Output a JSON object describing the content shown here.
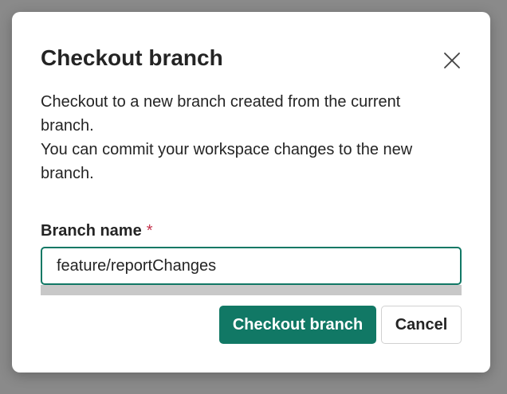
{
  "dialog": {
    "title": "Checkout branch",
    "close_icon": "close-icon",
    "description_lines": [
      "Checkout to a new branch created from the current branch.",
      "You can commit your workspace changes to the new branch."
    ],
    "field": {
      "label": "Branch name",
      "required_marker": "*",
      "value": "feature/reportChanges"
    },
    "primary_button": "Checkout branch",
    "secondary_button": "Cancel"
  },
  "colors": {
    "accent": "#117865",
    "required": "#c4314b",
    "text": "#242424"
  }
}
